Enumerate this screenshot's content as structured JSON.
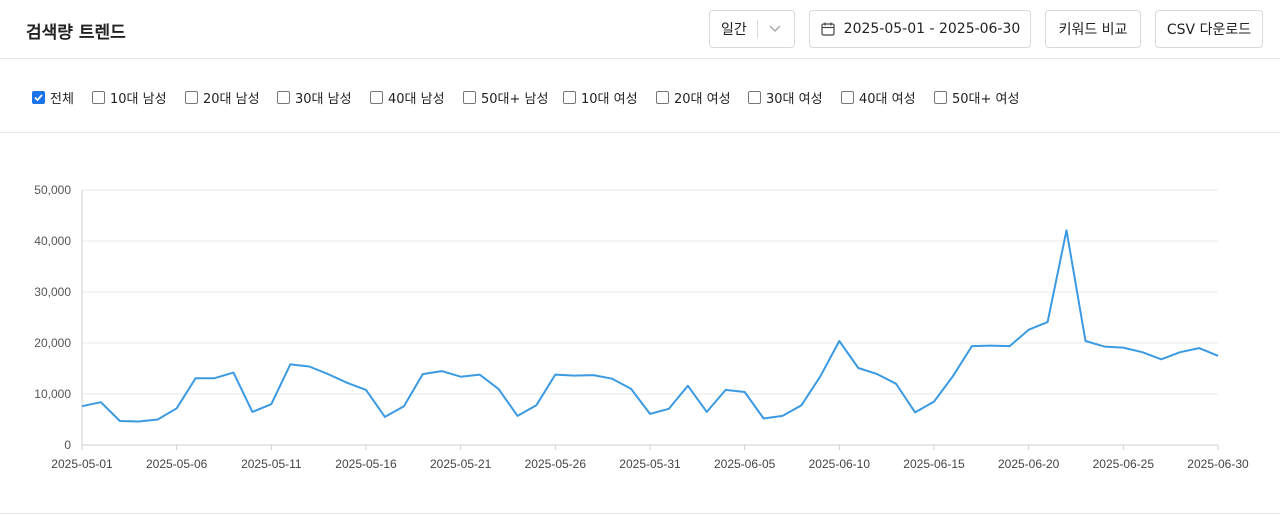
{
  "header": {
    "title": "검색량 트렌드",
    "period": {
      "value": "일간"
    },
    "date_range": "2025-05-01 - 2025-06-30",
    "compare_label": "키워드 비교",
    "csv_label": "CSV 다운로드"
  },
  "filters": [
    {
      "label": "전체",
      "checked": true
    },
    {
      "label": "10대 남성",
      "checked": false
    },
    {
      "label": "20대 남성",
      "checked": false
    },
    {
      "label": "30대 남성",
      "checked": false
    },
    {
      "label": "40대 남성",
      "checked": false
    },
    {
      "label": "50대+ 남성",
      "checked": false
    },
    {
      "label": "10대 여성",
      "checked": false
    },
    {
      "label": "20대 여성",
      "checked": false
    },
    {
      "label": "30대 여성",
      "checked": false
    },
    {
      "label": "40대 여성",
      "checked": false
    },
    {
      "label": "50대+ 여성",
      "checked": false
    }
  ],
  "chart_data": {
    "type": "line",
    "title": "",
    "xlabel": "",
    "ylabel": "",
    "ylim": [
      0,
      50000
    ],
    "y_ticks": [
      "0",
      "10,000",
      "20,000",
      "30,000",
      "40,000",
      "50,000"
    ],
    "x_tick_labels": [
      "2025-05-01",
      "2025-05-06",
      "2025-05-11",
      "2025-05-16",
      "2025-05-21",
      "2025-05-26",
      "2025-05-31",
      "2025-06-05",
      "2025-06-10",
      "2025-06-15",
      "2025-06-20",
      "2025-06-25",
      "2025-06-30"
    ],
    "grid": true,
    "line_color": "#3b9ae1",
    "series": [
      {
        "x": [
          "2025-05-01",
          "2025-05-02",
          "2025-05-03",
          "2025-05-04",
          "2025-05-05",
          "2025-05-06",
          "2025-05-07",
          "2025-05-08",
          "2025-05-09",
          "2025-05-10",
          "2025-05-11",
          "2025-05-12",
          "2025-05-13",
          "2025-05-14",
          "2025-05-15",
          "2025-05-16",
          "2025-05-17",
          "2025-05-18",
          "2025-05-19",
          "2025-05-20",
          "2025-05-21",
          "2025-05-22",
          "2025-05-23",
          "2025-05-24",
          "2025-05-25",
          "2025-05-26",
          "2025-05-27",
          "2025-05-28",
          "2025-05-29",
          "2025-05-30",
          "2025-05-31",
          "2025-06-01",
          "2025-06-02",
          "2025-06-03",
          "2025-06-04",
          "2025-06-05",
          "2025-06-06",
          "2025-06-07",
          "2025-06-08",
          "2025-06-09",
          "2025-06-10",
          "2025-06-11",
          "2025-06-12",
          "2025-06-13",
          "2025-06-14",
          "2025-06-15",
          "2025-06-16",
          "2025-06-17",
          "2025-06-18",
          "2025-06-19",
          "2025-06-20",
          "2025-06-21",
          "2025-06-22",
          "2025-06-23",
          "2025-06-24",
          "2025-06-25",
          "2025-06-26",
          "2025-06-27",
          "2025-06-28",
          "2025-06-29",
          "2025-06-30"
        ],
        "values": [
          7600,
          8400,
          4700,
          4600,
          5000,
          7200,
          13100,
          13100,
          14200,
          6500,
          8000,
          15800,
          15400,
          13900,
          12200,
          10800,
          5500,
          7600,
          13900,
          14500,
          13400,
          13800,
          11000,
          5700,
          7800,
          13800,
          13600,
          13700,
          13000,
          11000,
          6100,
          7100,
          11600,
          6500,
          10800,
          10400,
          5200,
          5700,
          7800,
          13500,
          20400,
          15100,
          13900,
          12000,
          6400,
          8500,
          13500,
          19400,
          19500,
          19400,
          22600,
          24100,
          42100,
          20400,
          19300,
          19100,
          18200,
          16800,
          18200,
          19000,
          17500
        ]
      }
    ]
  }
}
